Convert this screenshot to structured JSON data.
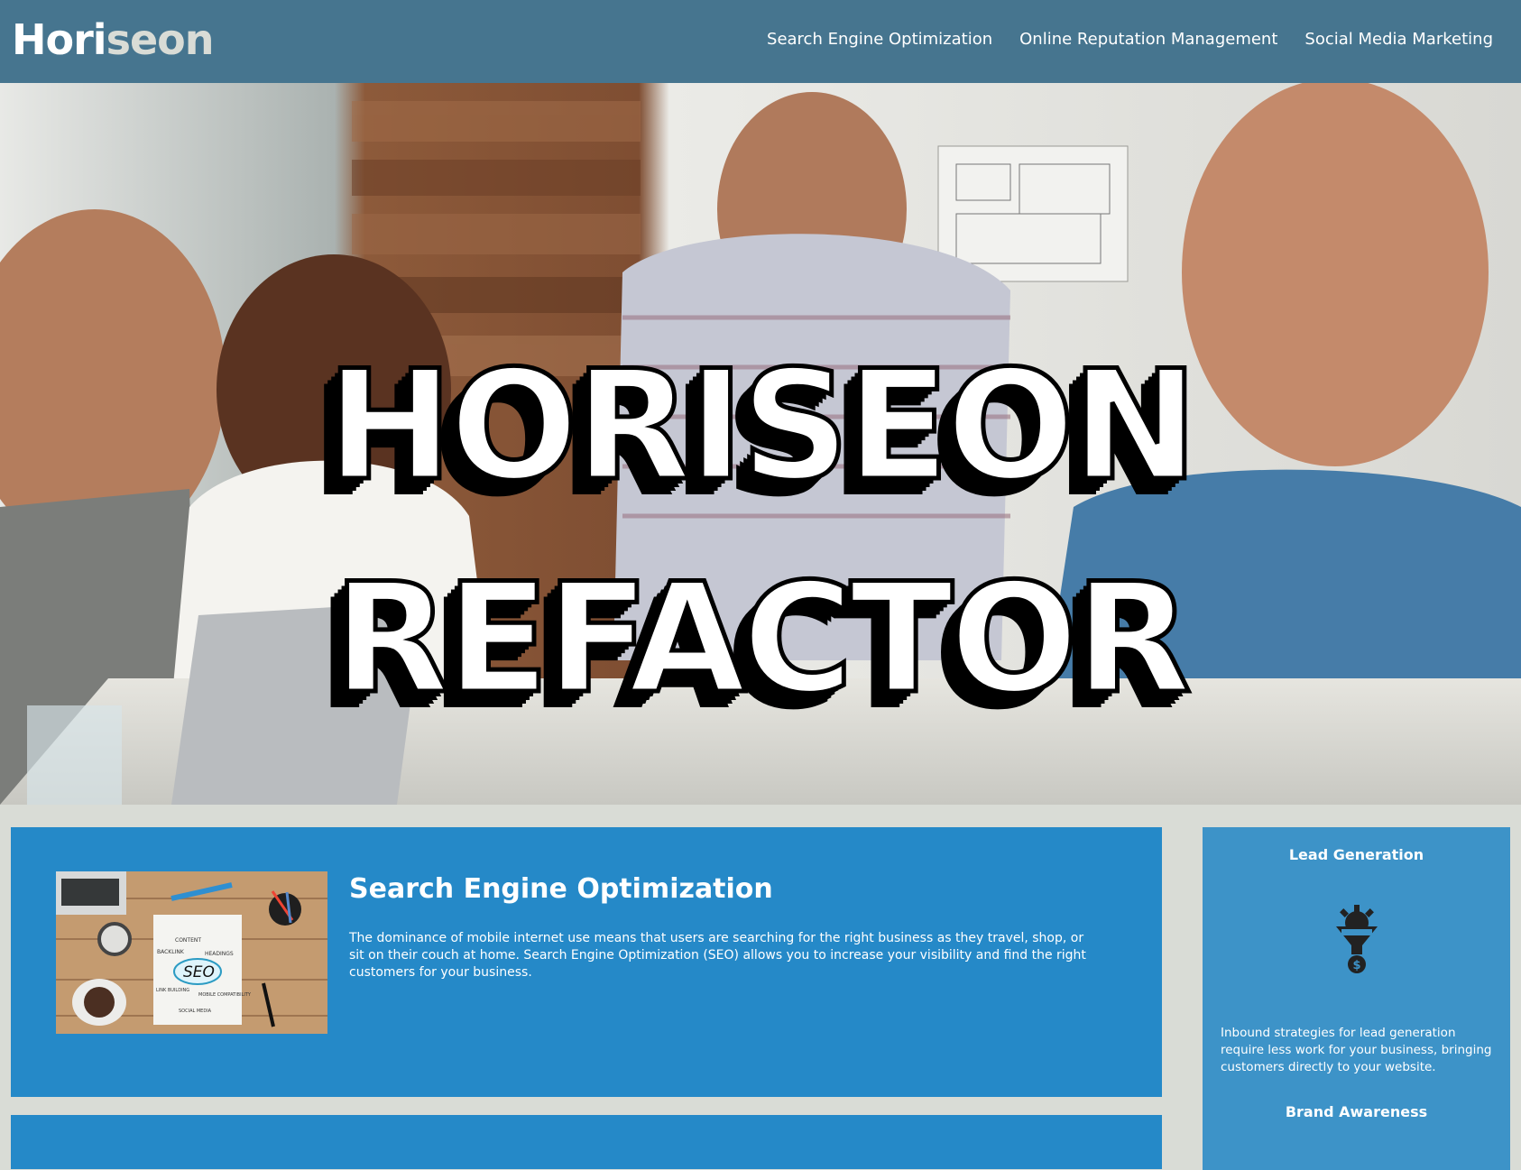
{
  "header": {
    "logo_main": "Hori",
    "logo_accent": "seon",
    "nav": [
      {
        "label": "Search Engine Optimization"
      },
      {
        "label": "Online Reputation Management"
      },
      {
        "label": "Social Media Marketing"
      }
    ]
  },
  "hero": {
    "line1": "HORISEON",
    "line2": "REFACTOR"
  },
  "main": {
    "seo_card": {
      "title": "Search Engine Optimization",
      "text": "The dominance of mobile internet use means that users are searching for the right business as they travel, shop, or sit on their couch at home. Search Engine Optimization (SEO) allows you to increase your visibility and find the right customers for your business.",
      "image_words": [
        "CONTENT",
        "BACKLINK",
        "HEADINGS",
        "SEO",
        "LINK BUILDING",
        "MOBILE COMPATIBILITY",
        "SOCIAL MEDIA"
      ]
    }
  },
  "sidebar": {
    "lead_title": "Lead Generation",
    "lead_text": "Inbound strategies for lead generation require less work for your business, bringing customers directly to your website.",
    "brand_title": "Brand Awareness"
  },
  "colors": {
    "header_bg": "#46758f",
    "page_bg": "#d9dcd6",
    "card_bg": "#2589c8",
    "sidebar_bg": "#3d93c8"
  },
  "icons": {
    "lead_icon": "funnel-gear-dollar-icon"
  }
}
